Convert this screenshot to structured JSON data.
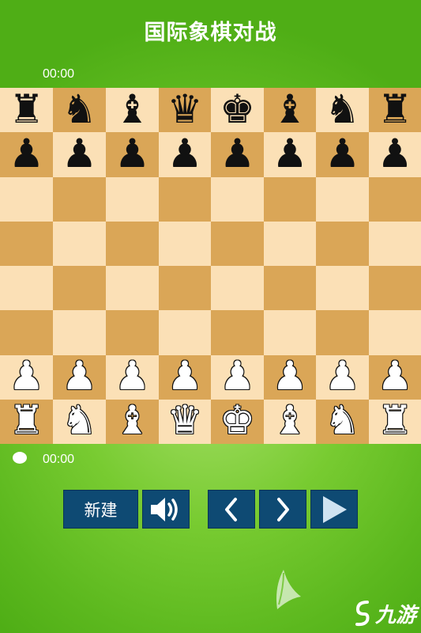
{
  "title": "国际象棋对战",
  "timers": {
    "top": "00:00",
    "bottom": "00:00"
  },
  "board": {
    "light_color": "#fbe0b6",
    "dark_color": "#daa657",
    "ranks": [
      [
        "br",
        "bn",
        "bb",
        "bq",
        "bk",
        "bb",
        "bn",
        "br"
      ],
      [
        "bp",
        "bp",
        "bp",
        "bp",
        "bp",
        "bp",
        "bp",
        "bp"
      ],
      [
        "",
        "",
        "",
        "",
        "",
        "",
        "",
        ""
      ],
      [
        "",
        "",
        "",
        "",
        "",
        "",
        "",
        ""
      ],
      [
        "",
        "",
        "",
        "",
        "",
        "",
        "",
        ""
      ],
      [
        "",
        "",
        "",
        "",
        "",
        "",
        "",
        ""
      ],
      [
        "wp",
        "wp",
        "wp",
        "wp",
        "wp",
        "wp",
        "wp",
        "wp"
      ],
      [
        "wr",
        "wn",
        "wb",
        "wq",
        "wk",
        "wb",
        "wn",
        "wr"
      ]
    ]
  },
  "controls": {
    "new_label": "新建",
    "sound_icon": "speaker-icon",
    "prev_icon": "chevron-left-icon",
    "next_icon": "chevron-right-icon",
    "play_icon": "play-icon",
    "button_color": "#0e4a73"
  },
  "watermark": {
    "logo_text": "九游"
  }
}
